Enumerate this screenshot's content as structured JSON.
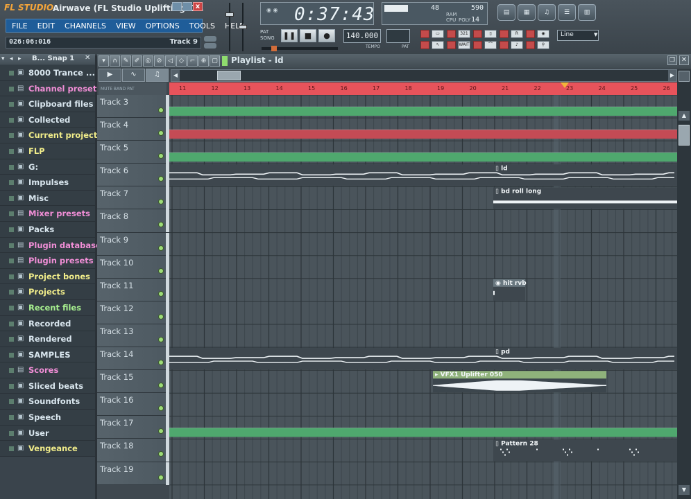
{
  "app": {
    "logo": "FL STUDIO",
    "title": "Airwave (FL Studio Uplifting C...",
    "close_label": "x"
  },
  "menu": [
    "FILE",
    "EDIT",
    "CHANNELS",
    "VIEW",
    "OPTIONS",
    "TOOLS",
    "HELP"
  ],
  "hint": {
    "position": "026:06:016",
    "target": "Track 9"
  },
  "time_display": {
    "value": "0:37:43"
  },
  "monitor": {
    "cpu_value": "48",
    "poly_value": "590",
    "ram_label": "RAM",
    "cpu_label": "CPU",
    "poly_label": "POLY",
    "poly_small": "14"
  },
  "transport": {
    "mode_pat": "PAT",
    "mode_song": "SONG",
    "pause_glyph": "❚❚",
    "stop_glyph": "■",
    "record_glyph": "●",
    "tempo": "140.000",
    "tempo_label": "TEMPO",
    "pat_label": "PAT"
  },
  "snap": {
    "value": "Line"
  },
  "browser": {
    "title": "B... Snap 1",
    "items": [
      {
        "label": "8000 Trance ...",
        "color": "c"
      },
      {
        "label": "Channel presets",
        "color": "p"
      },
      {
        "label": "Clipboard files",
        "color": "c"
      },
      {
        "label": "Collected",
        "color": "c"
      },
      {
        "label": "Current project",
        "color": "y"
      },
      {
        "label": "FLP",
        "color": "y"
      },
      {
        "label": "G:",
        "color": "c"
      },
      {
        "label": "Impulses",
        "color": "c"
      },
      {
        "label": "Misc",
        "color": "c"
      },
      {
        "label": "Mixer presets",
        "color": "p"
      },
      {
        "label": "Packs",
        "color": "c"
      },
      {
        "label": "Plugin database",
        "color": "p"
      },
      {
        "label": "Plugin presets",
        "color": "p"
      },
      {
        "label": "Project bones",
        "color": "y"
      },
      {
        "label": "Projects",
        "color": "y"
      },
      {
        "label": "Recent files",
        "color": "g"
      },
      {
        "label": "Recorded",
        "color": "c"
      },
      {
        "label": "Rendered",
        "color": "c"
      },
      {
        "label": "SAMPLES",
        "color": "c"
      },
      {
        "label": "Scores",
        "color": "p"
      },
      {
        "label": "Sliced beats",
        "color": "c"
      },
      {
        "label": "Soundfonts",
        "color": "c"
      },
      {
        "label": "Speech",
        "color": "c"
      },
      {
        "label": "User",
        "color": "c"
      },
      {
        "label": "Vengeance",
        "color": "y"
      }
    ]
  },
  "playlist": {
    "title": "Playlist - ld",
    "ruler_labels": "MUTE BAND PAT",
    "ruler_numbers": [
      "11",
      "12",
      "13",
      "14",
      "15",
      "16",
      "17",
      "18",
      "19",
      "20",
      "21",
      "22",
      "23",
      "24",
      "25",
      "26"
    ],
    "tracks": [
      "Track 3",
      "Track 4",
      "Track 5",
      "Track 6",
      "Track 7",
      "Track 8",
      "Track 9",
      "Track 10",
      "Track 11",
      "Track 12",
      "Track 13",
      "Track 14",
      "Track 15",
      "Track 16",
      "Track 17",
      "Track 18",
      "Track 19"
    ],
    "clips": [
      {
        "track": 0,
        "label": "",
        "kind": "green-band"
      },
      {
        "track": 1,
        "label": "",
        "kind": "red-band"
      },
      {
        "track": 2,
        "label": "",
        "kind": "green-band"
      },
      {
        "track": 3,
        "label": "ld",
        "kind": "pattern-line"
      },
      {
        "track": 4,
        "label": "bd roll long",
        "kind": "pattern-bar"
      },
      {
        "track": 8,
        "label": "hit rvb",
        "kind": "audio-small"
      },
      {
        "track": 11,
        "label": "pd",
        "kind": "pattern-line"
      },
      {
        "track": 12,
        "label": "VFX1 Uplifter 050",
        "kind": "audio-wave"
      },
      {
        "track": 14,
        "label": "",
        "kind": "green-band"
      },
      {
        "track": 15,
        "label": "Pattern 28",
        "kind": "pattern-dots"
      }
    ]
  },
  "colors": {
    "green": "#4fa86e",
    "red": "#c44b55",
    "ruler": "#e7535b",
    "pattern_bg": "#3e474e"
  }
}
